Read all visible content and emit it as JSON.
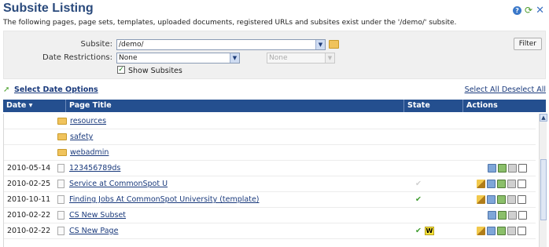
{
  "header": {
    "title": "Subsite Listing",
    "description": "The following pages, page sets, templates, uploaded documents, registered URLs and subsites exist under the '/demo/' subsite."
  },
  "filters": {
    "subsite_label": "Subsite:",
    "subsite_value": "/demo/",
    "date_label": "Date Restrictions:",
    "date_value": "None",
    "date_second_value": "None",
    "show_subsites_label": "Show Subsites",
    "filter_button": "Filter"
  },
  "options": {
    "select_date_options": "Select Date Options",
    "select_all": "Select All",
    "deselect_all": "Deselect All"
  },
  "columns": {
    "date": "Date",
    "page_title": "Page Title",
    "state": "State",
    "actions": "Actions"
  },
  "rows": [
    {
      "date": "",
      "title": "resources",
      "kind": "folder",
      "state": ""
    },
    {
      "date": "",
      "title": "safety",
      "kind": "folder",
      "state": ""
    },
    {
      "date": "",
      "title": "webadmin",
      "kind": "folder",
      "state": ""
    },
    {
      "date": "2010-05-14",
      "title": "123456789ds",
      "kind": "pageset",
      "state": ""
    },
    {
      "date": "2010-02-25",
      "title": "Service at CommonSpot U",
      "kind": "page",
      "state": "light-check"
    },
    {
      "date": "2010-10-11",
      "title": "Finding Jobs At CommonSpot University (template)",
      "kind": "page",
      "state": "green-check"
    },
    {
      "date": "2010-02-22",
      "title": "CS New Subset",
      "kind": "pageset",
      "state": ""
    },
    {
      "date": "2010-02-22",
      "title": "CS New Page",
      "kind": "page",
      "state": "green-check-w",
      "badge": "W"
    }
  ]
}
